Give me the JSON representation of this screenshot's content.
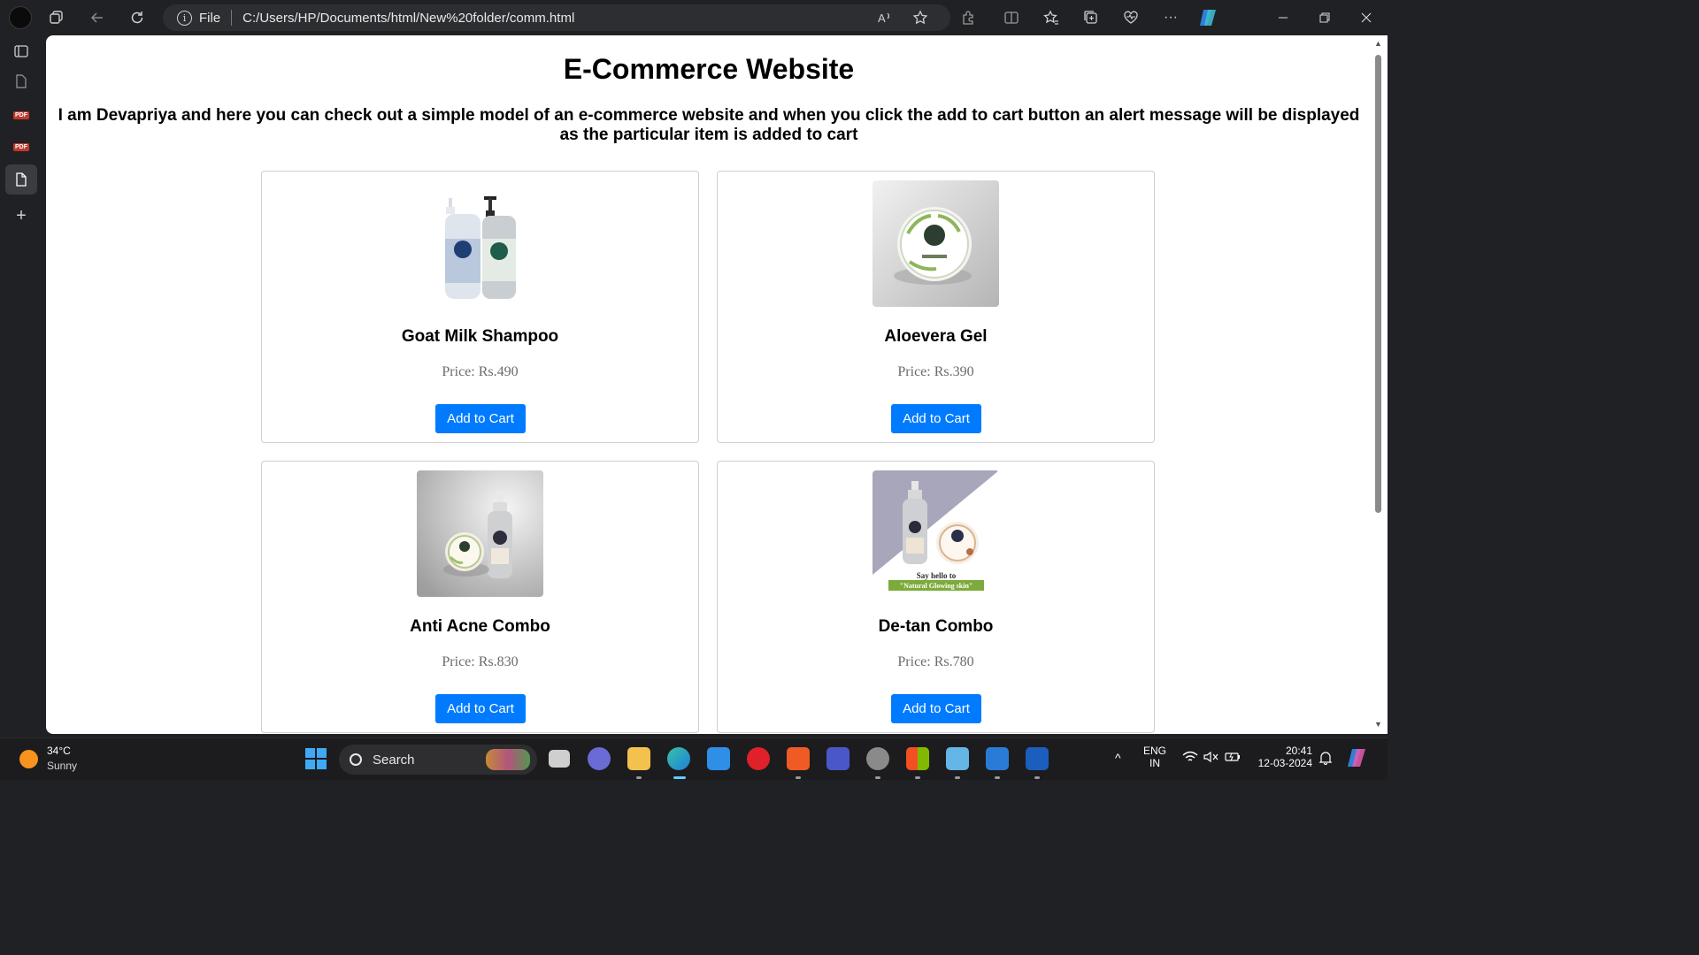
{
  "browser": {
    "address_scheme": "File",
    "url": "C:/Users/HP/Documents/html/New%20folder/comm.html"
  },
  "page": {
    "title": "E-Commerce Website",
    "intro": "I am Devapriya and here you can check out a simple model of an e-commerce website and when you click the add to cart button an alert message will be displayed as the particular item is added to cart",
    "products": [
      {
        "name": "Goat Milk Shampoo",
        "price": "Price: Rs.490",
        "button": "Add to Cart"
      },
      {
        "name": "Aloevera Gel",
        "price": "Price: Rs.390",
        "button": "Add to Cart"
      },
      {
        "name": "Anti Acne Combo",
        "price": "Price: Rs.830",
        "button": "Add to Cart"
      },
      {
        "name": "De-tan Combo",
        "price": "Price: Rs.780",
        "button": "Add to Cart",
        "image_caption_1": "Say hello to",
        "image_caption_2": "\"Natural Glowing skin\""
      }
    ]
  },
  "taskbar": {
    "weather_temp": "34°C",
    "weather_desc": "Sunny",
    "search_label": "Search",
    "lang_1": "ENG",
    "lang_2": "IN",
    "time": "20:41",
    "date": "12-03-2024"
  },
  "colors": {
    "button": "#007bff",
    "browser_chrome": "#202124"
  }
}
